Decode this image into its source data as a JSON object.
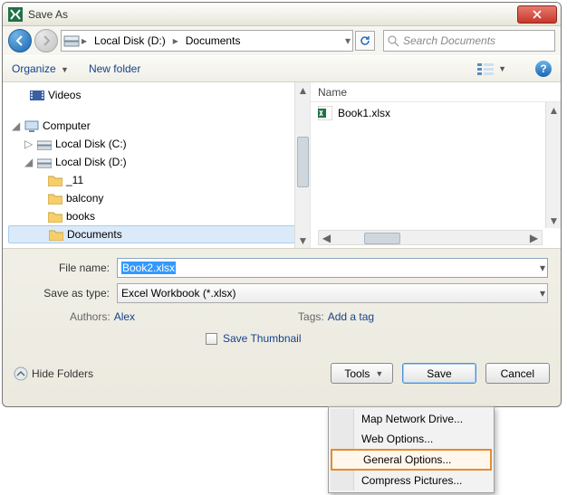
{
  "title": "Save As",
  "breadcrumb": {
    "seg1": "Local Disk (D:)",
    "seg2": "Documents"
  },
  "search": {
    "placeholder": "Search Documents"
  },
  "toolbar": {
    "organize": "Organize",
    "newfolder": "New folder"
  },
  "tree": {
    "videos": "Videos",
    "computer": "Computer",
    "driveC": "Local Disk (C:)",
    "driveD": "Local Disk (D:)",
    "f1": "_11",
    "f2": "balcony",
    "f3": "books",
    "f4": "Documents"
  },
  "filepane": {
    "col_name": "Name",
    "item1": "Book1.xlsx"
  },
  "form": {
    "filename_label": "File name:",
    "filename_value": "Book2.xlsx",
    "type_label": "Save as type:",
    "type_value": "Excel Workbook (*.xlsx)",
    "authors_k": "Authors:",
    "authors_v": "Alex",
    "tags_k": "Tags:",
    "tags_v": "Add a tag",
    "thumb": "Save Thumbnail"
  },
  "footer": {
    "hide": "Hide Folders",
    "tools": "Tools",
    "save": "Save",
    "cancel": "Cancel"
  },
  "menu": {
    "m1": "Map Network Drive...",
    "m2": "Web Options...",
    "m3": "General Options...",
    "m4": "Compress Pictures..."
  }
}
